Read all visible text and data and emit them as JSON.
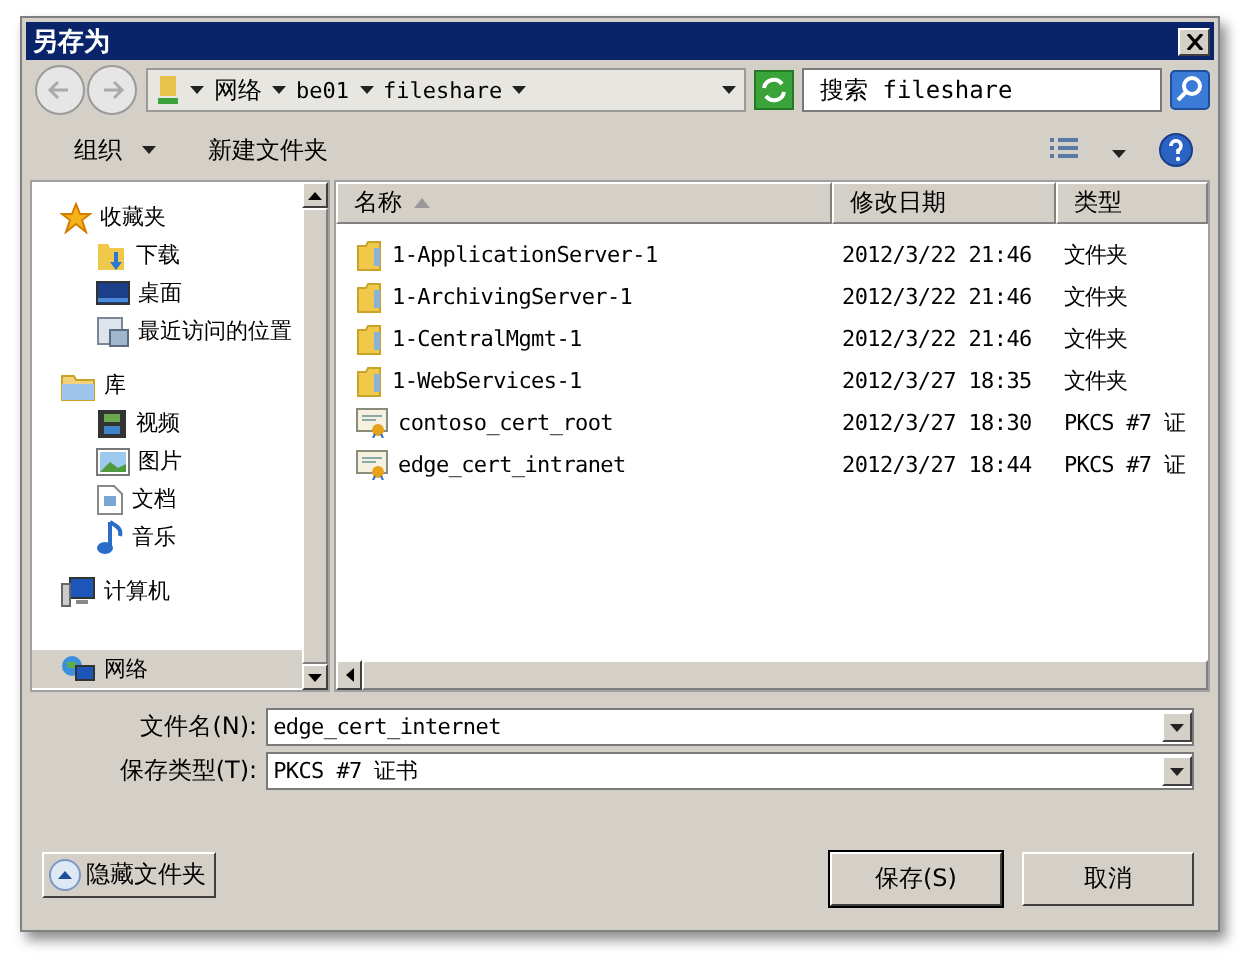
{
  "window": {
    "title": "另存为"
  },
  "address": {
    "crumbs": [
      "网络",
      "be01",
      "fileshare"
    ]
  },
  "search": {
    "placeholder": "搜索 fileshare"
  },
  "toolbar": {
    "items": [
      {
        "label": "组织",
        "kind": "menu"
      },
      {
        "label": "新建文件夹",
        "kind": "button"
      }
    ]
  },
  "sidebar": {
    "groups": [
      {
        "label": "收藏夹",
        "selected": false,
        "children": [
          {
            "label": "下载",
            "selected": false
          },
          {
            "label": "桌面",
            "selected": false
          },
          {
            "label": "最近访问的位置",
            "selected": false
          }
        ]
      },
      {
        "label": "库",
        "selected": false,
        "children": [
          {
            "label": "视频",
            "selected": false
          },
          {
            "label": "图片",
            "selected": false
          },
          {
            "label": "文档",
            "selected": false
          },
          {
            "label": "音乐",
            "selected": false
          }
        ]
      },
      {
        "label": "计算机",
        "selected": false
      },
      {
        "label": "网络",
        "selected": true
      }
    ]
  },
  "table": {
    "columns": [
      {
        "label": "名称",
        "sorted": true
      },
      {
        "label": "修改日期",
        "sorted": false
      },
      {
        "label": "类型",
        "sorted": false
      }
    ],
    "rows": [
      {
        "kind": "folder",
        "name": "1-ApplicationServer-1",
        "modified": "2012/3/22 21:46",
        "type": "文件夹"
      },
      {
        "kind": "folder",
        "name": "1-ArchivingServer-1",
        "modified": "2012/3/22 21:46",
        "type": "文件夹"
      },
      {
        "kind": "folder",
        "name": "1-CentralMgmt-1",
        "modified": "2012/3/22 21:46",
        "type": "文件夹"
      },
      {
        "kind": "folder",
        "name": "1-WebServices-1",
        "modified": "2012/3/27 18:35",
        "type": "文件夹"
      },
      {
        "kind": "certificate",
        "name": "contoso_cert_root",
        "modified": "2012/3/27 18:30",
        "type": "PKCS #7 证"
      },
      {
        "kind": "certificate",
        "name": "edge_cert_intranet",
        "modified": "2012/3/27 18:44",
        "type": "PKCS #7 证"
      }
    ]
  },
  "fields": [
    {
      "label": "文件名(N):",
      "value": "edge_cert_internet"
    },
    {
      "label": "保存类型(T):",
      "value": "PKCS #7 证书"
    }
  ],
  "hide_folders": {
    "label": "隐藏文件夹"
  },
  "buttons": [
    {
      "label": "保存(S)",
      "kind": "default"
    },
    {
      "label": "取消",
      "kind": "normal"
    }
  ]
}
